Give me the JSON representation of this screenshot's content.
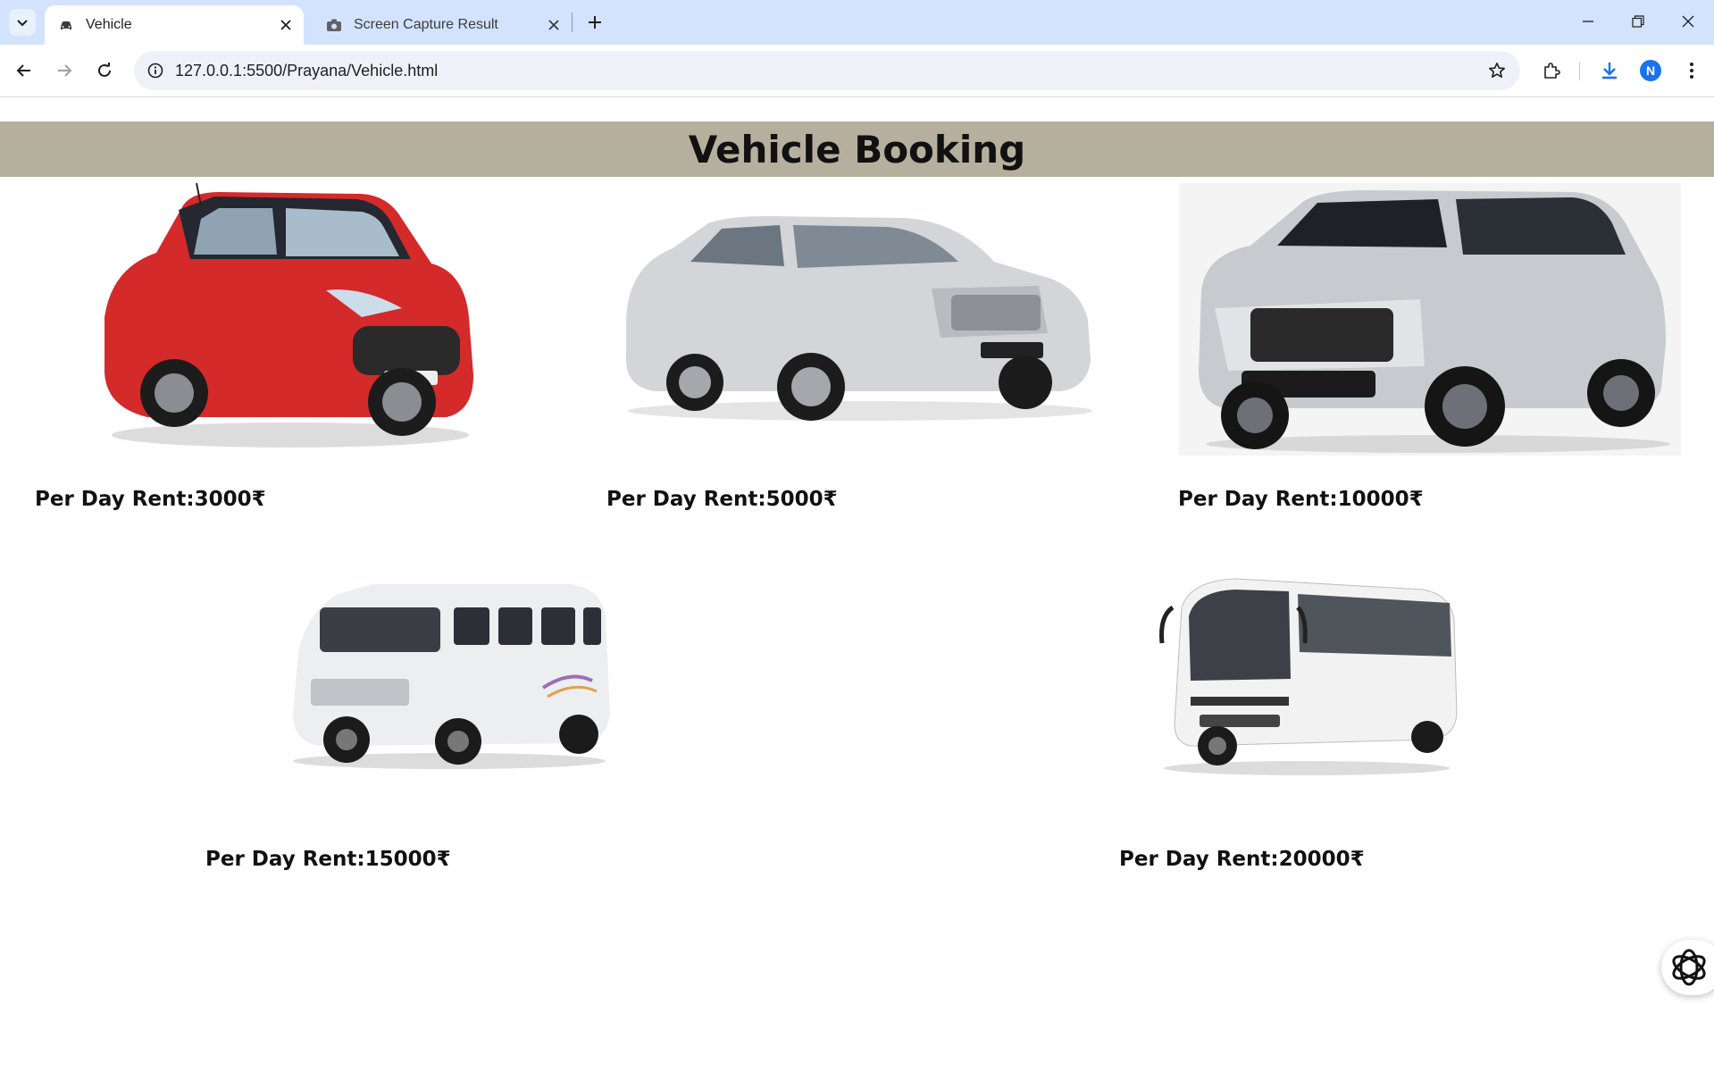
{
  "browser": {
    "tabs": [
      {
        "title": "Vehicle",
        "icon": "car-icon",
        "active": true
      },
      {
        "title": "Screen Capture Result",
        "icon": "camera-icon",
        "active": false
      }
    ],
    "url": "127.0.0.1:5500/Prayana/Vehicle.html",
    "profile_initial": "N"
  },
  "page": {
    "heading": "Vehicle Booking",
    "vehicles": [
      {
        "name": "hatchback-car",
        "rent": "Per Day Rent:3000₹"
      },
      {
        "name": "mpv-car",
        "rent": "Per Day Rent:5000₹"
      },
      {
        "name": "suv-car",
        "rent": "Per Day Rent:10000₹"
      },
      {
        "name": "traveller-van",
        "rent": "Per Day Rent:15000₹"
      },
      {
        "name": "coach-bus",
        "rent": "Per Day Rent:20000₹"
      }
    ]
  },
  "colors": {
    "banner": "#b5b09d",
    "tabstrip": "#d3e3fd",
    "accent": "#1a73e8"
  }
}
